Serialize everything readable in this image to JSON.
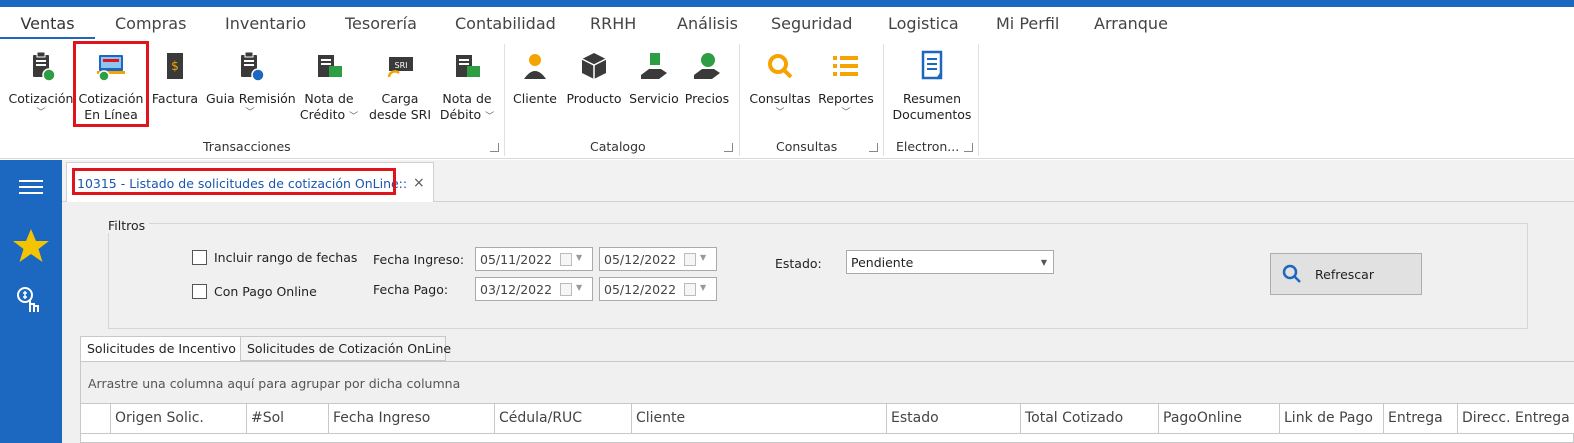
{
  "ribbon_tabs": [
    "Ventas",
    "Compras",
    "Inventario",
    "Tesorería",
    "Contabilidad",
    "RRHH",
    "Análisis",
    "Seguridad",
    "Logistica",
    "Mi Perfil",
    "Arranque"
  ],
  "ribbon": {
    "transacciones": {
      "label": "Transacciones",
      "buttons": [
        {
          "line1": "Cotización",
          "line2": ""
        },
        {
          "line1": "Cotización",
          "line2": "En Línea"
        },
        {
          "line1": "Factura",
          "line2": ""
        },
        {
          "line1": "Guia Remisión",
          "line2": ""
        },
        {
          "line1": "Nota de",
          "line2": "Crédito"
        },
        {
          "line1": "Carga",
          "line2": "desde SRI"
        },
        {
          "line1": "Nota de",
          "line2": "Débito"
        }
      ]
    },
    "catalogo": {
      "label": "Catalogo",
      "buttons": [
        "Cliente",
        "Producto",
        "Servicio",
        "Precios"
      ]
    },
    "consultas": {
      "label": "Consultas",
      "buttons": [
        "Consultas",
        "Reportes"
      ]
    },
    "electronica": {
      "label": "Electron...",
      "buttons": [
        {
          "line1": "Resumen",
          "line2": "Documentos"
        }
      ]
    }
  },
  "icons": {
    "invoice_badge": "$",
    "sri_label": "SRI"
  },
  "document_tab": {
    "title": "10315 - Listado de solicitudes de cotización OnLine::",
    "close": "×"
  },
  "filters": {
    "title": "Filtros",
    "include_range": "Incluir rango de fechas",
    "online_payment": "Con Pago Online",
    "fecha_ingreso_label": "Fecha Ingreso:",
    "fecha_ingreso_from": "05/11/2022",
    "fecha_ingreso_to": "05/12/2022",
    "fecha_pago_label": "Fecha Pago:",
    "fecha_pago_from": "03/12/2022",
    "fecha_pago_to": "05/12/2022",
    "estado_label": "Estado:",
    "estado_value": "Pendiente",
    "refresh": "Refrescar"
  },
  "subtabs": [
    "Solicitudes de Incentivo",
    "Solicitudes de Cotización OnLine"
  ],
  "grid": {
    "group_hint": "Arrastre una columna aquí para agrupar por dicha columna",
    "columns": [
      "Origen Solic.",
      "#Sol",
      "Fecha Ingreso",
      "Cédula/RUC",
      "Cliente",
      "Estado",
      "Total Cotizado",
      "PagoOnline",
      "Link de Pago",
      "Entrega",
      "Direcc. Entrega"
    ]
  },
  "colors": {
    "accent": "#1c67c0",
    "highlight": "#e0141b",
    "icon_dark": "#3a3a3a",
    "icon_green": "#2e9e44",
    "icon_orange": "#f5a300",
    "icon_blue": "#1c67c0"
  }
}
